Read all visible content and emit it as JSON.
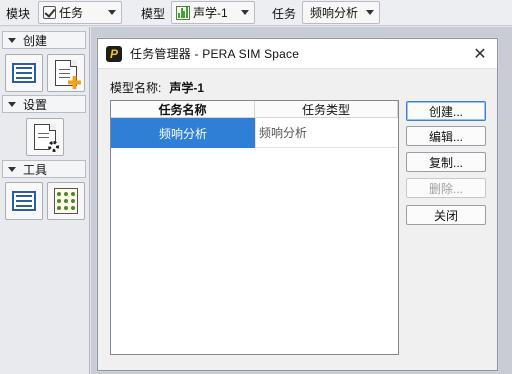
{
  "toolbar": {
    "module_label": "模块",
    "module_value": "任务",
    "model_label": "模型",
    "model_value": "声学-1",
    "task_label": "任务",
    "task_value": "频响分析"
  },
  "sidebar": {
    "sections": [
      {
        "label": "创建",
        "icons": [
          "list-icon",
          "new-doc-icon"
        ]
      },
      {
        "label": "设置",
        "icons": [
          "doc-settings-icon"
        ]
      },
      {
        "label": "工具",
        "icons": [
          "list-icon",
          "dots-grid-icon"
        ]
      }
    ]
  },
  "dialog": {
    "title": "任务管理器 - PERA SIM Space",
    "logo_letter": "P",
    "close_glyph": "✕",
    "model_name_label": "模型名称:",
    "model_name_value": "声学-1",
    "table": {
      "columns": [
        "任务名称",
        "任务类型"
      ],
      "rows": [
        {
          "name": "频响分析",
          "type": "频响分析",
          "selected": true
        }
      ]
    },
    "buttons": {
      "create": "创建...",
      "edit": "编辑...",
      "copy": "复制...",
      "delete": "删除...",
      "close": "关闭"
    }
  },
  "colors": {
    "selection": "#2f7fd6",
    "workspace": "#c9ccd5",
    "accent_orange": "#f2a21f"
  }
}
